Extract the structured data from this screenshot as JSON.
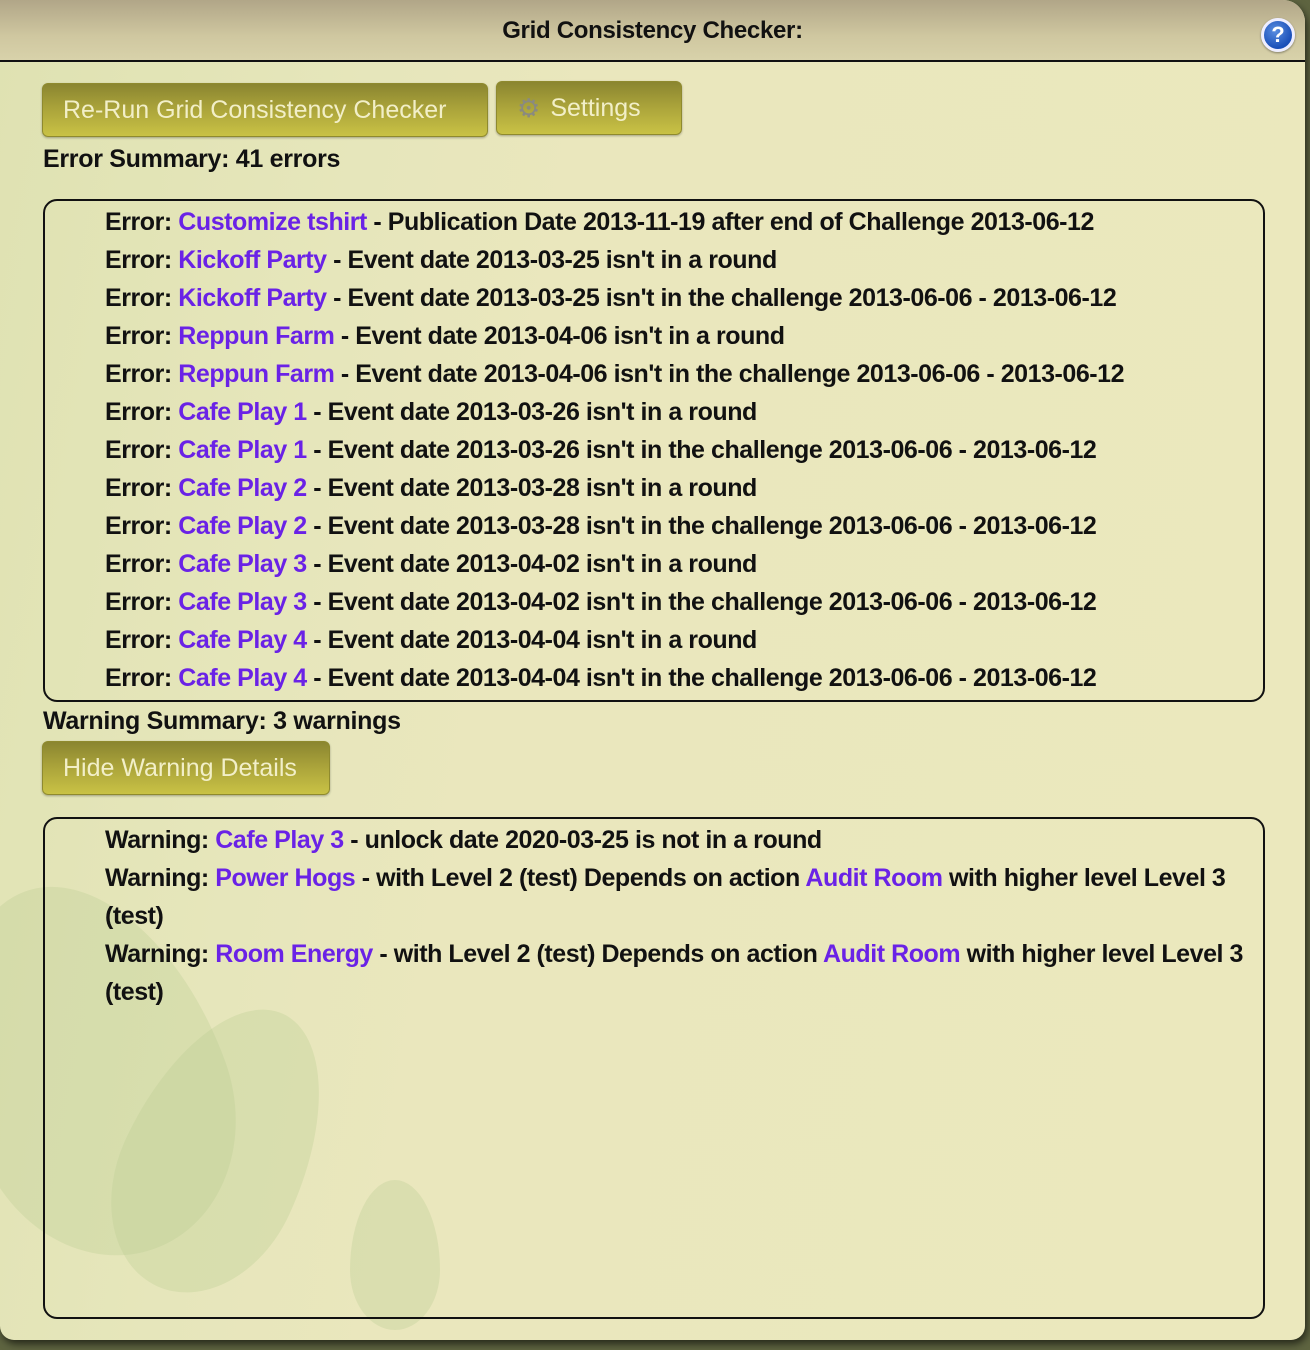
{
  "title": "Grid Consistency Checker:",
  "help_icon": "question-icon",
  "buttons": {
    "rerun": "Re-Run Grid Consistency Checker",
    "settings": "Settings",
    "settings_icon": "gears-icon",
    "hide_warnings": "Hide Warning Details"
  },
  "error_summary": "Error Summary: 41 errors",
  "warning_summary": "Warning Summary: 3 warnings",
  "link_color": "#6a22e6",
  "errors": [
    [
      [
        "t",
        "Error: "
      ],
      [
        "l",
        "Customize tshirt"
      ],
      [
        "t",
        " - Publication Date 2013-11-19 after end of Challenge 2013-06-12"
      ]
    ],
    [
      [
        "t",
        "Error: "
      ],
      [
        "l",
        "Kickoff Party"
      ],
      [
        "t",
        " - Event date 2013-03-25 isn't in a round"
      ]
    ],
    [
      [
        "t",
        "Error: "
      ],
      [
        "l",
        "Kickoff Party"
      ],
      [
        "t",
        " - Event date 2013-03-25 isn't in the challenge 2013-06-06 - 2013-06-12"
      ]
    ],
    [
      [
        "t",
        "Error: "
      ],
      [
        "l",
        "Reppun Farm"
      ],
      [
        "t",
        " - Event date 2013-04-06 isn't in a round"
      ]
    ],
    [
      [
        "t",
        "Error: "
      ],
      [
        "l",
        "Reppun Farm"
      ],
      [
        "t",
        " - Event date 2013-04-06 isn't in the challenge 2013-06-06 - 2013-06-12"
      ]
    ],
    [
      [
        "t",
        "Error: "
      ],
      [
        "l",
        "Cafe Play 1"
      ],
      [
        "t",
        " - Event date 2013-03-26 isn't in a round"
      ]
    ],
    [
      [
        "t",
        "Error: "
      ],
      [
        "l",
        "Cafe Play 1"
      ],
      [
        "t",
        " - Event date 2013-03-26 isn't in the challenge 2013-06-06 - 2013-06-12"
      ]
    ],
    [
      [
        "t",
        "Error: "
      ],
      [
        "l",
        "Cafe Play 2"
      ],
      [
        "t",
        " - Event date 2013-03-28 isn't in a round"
      ]
    ],
    [
      [
        "t",
        "Error: "
      ],
      [
        "l",
        "Cafe Play 2"
      ],
      [
        "t",
        " - Event date 2013-03-28 isn't in the challenge 2013-06-06 - 2013-06-12"
      ]
    ],
    [
      [
        "t",
        "Error: "
      ],
      [
        "l",
        "Cafe Play 3"
      ],
      [
        "t",
        " - Event date 2013-04-02 isn't in a round"
      ]
    ],
    [
      [
        "t",
        "Error: "
      ],
      [
        "l",
        "Cafe Play 3"
      ],
      [
        "t",
        " - Event date 2013-04-02 isn't in the challenge 2013-06-06 - 2013-06-12"
      ]
    ],
    [
      [
        "t",
        "Error: "
      ],
      [
        "l",
        "Cafe Play 4"
      ],
      [
        "t",
        " - Event date 2013-04-04 isn't in a round"
      ]
    ],
    [
      [
        "t",
        "Error: "
      ],
      [
        "l",
        "Cafe Play 4"
      ],
      [
        "t",
        " - Event date 2013-04-04 isn't in the challenge 2013-06-06 - 2013-06-12"
      ]
    ]
  ],
  "warnings": [
    [
      [
        "t",
        "Warning: "
      ],
      [
        "l",
        "Cafe Play 3"
      ],
      [
        "t",
        " - unlock date 2020-03-25 is not in a round"
      ]
    ],
    [
      [
        "t",
        "Warning: "
      ],
      [
        "l",
        "Power Hogs"
      ],
      [
        "t",
        " - with Level 2 (test) Depends on action "
      ],
      [
        "l",
        "Audit Room"
      ],
      [
        "t",
        " with higher level Level 3 (test)"
      ]
    ],
    [
      [
        "t",
        "Warning: "
      ],
      [
        "l",
        "Room Energy"
      ],
      [
        "t",
        " - with Level 2 (test) Depends on action "
      ],
      [
        "l",
        "Audit Room"
      ],
      [
        "t",
        " with higher level Level 3 (test)"
      ]
    ]
  ]
}
